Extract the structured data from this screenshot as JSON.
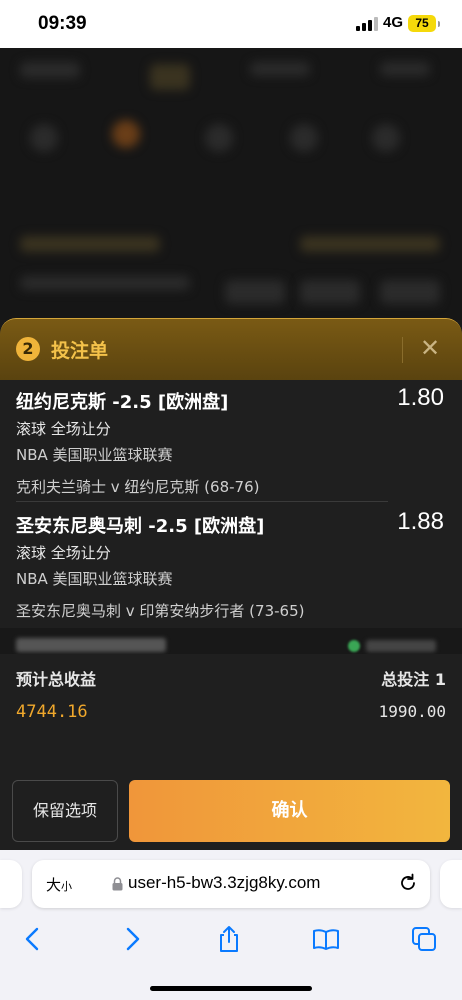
{
  "status_bar": {
    "time": "09:39",
    "network": "4G",
    "battery": "75"
  },
  "bet_slip": {
    "count": "2",
    "title": "投注单",
    "close_icon": "close-icon",
    "bets": [
      {
        "selection": "纽约尼克斯 -2.5 [欧洲盘]",
        "odds": "1.80",
        "market": "滚球 全场让分",
        "league": "NBA 美国职业篮球联赛",
        "match": "克利夫兰骑士 v 纽约尼克斯 (68-76)"
      },
      {
        "selection": "圣安东尼奥马刺 -2.5 [欧洲盘]",
        "odds": "1.88",
        "market": "滚球 全场让分",
        "league": "NBA 美国职业篮球联赛",
        "match": "圣安东尼奥马刺 v 印第安纳步行者 (73-65)"
      }
    ],
    "summary": {
      "est_return_label": "预计总收益",
      "est_return_value": "4744.16",
      "total_stake_label": "总投注 1",
      "total_stake_value": "1990.00"
    },
    "buttons": {
      "keep_selections": "保留选项",
      "confirm": "确认"
    }
  },
  "browser": {
    "text_size_label": "大",
    "text_size_small": "小",
    "url": "user-h5-bw3.3zjg8ky.com"
  },
  "colors": {
    "accent": "#f0a82c",
    "header_gold": "#f4c24a",
    "confirm_start": "#f0963a",
    "confirm_end": "#f2b63e"
  }
}
